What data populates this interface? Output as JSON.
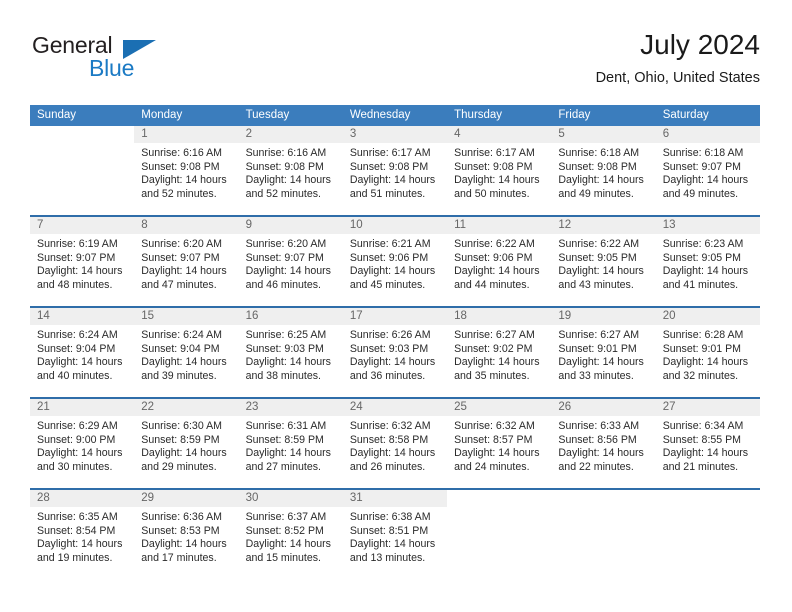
{
  "brand": {
    "name_part1": "General",
    "name_part2": "Blue",
    "triangle_icon": "triangle-icon",
    "accent_color": "#1b7ac4"
  },
  "header": {
    "title": "July 2024",
    "subtitle": "Dent, Ohio, United States"
  },
  "colors": {
    "header_blue": "#3b7dbd",
    "row_divider_blue": "#2f6da9",
    "daynum_bg": "#efefef",
    "text": "#2a2a2a"
  },
  "weekday_headers": [
    "Sunday",
    "Monday",
    "Tuesday",
    "Wednesday",
    "Thursday",
    "Friday",
    "Saturday"
  ],
  "weeks": [
    [
      {
        "day": "",
        "sunrise": "",
        "sunset": "",
        "daylight_line1": "",
        "daylight_line2": "",
        "empty": true
      },
      {
        "day": "1",
        "sunrise": "Sunrise: 6:16 AM",
        "sunset": "Sunset: 9:08 PM",
        "daylight_line1": "Daylight: 14 hours",
        "daylight_line2": "and 52 minutes."
      },
      {
        "day": "2",
        "sunrise": "Sunrise: 6:16 AM",
        "sunset": "Sunset: 9:08 PM",
        "daylight_line1": "Daylight: 14 hours",
        "daylight_line2": "and 52 minutes."
      },
      {
        "day": "3",
        "sunrise": "Sunrise: 6:17 AM",
        "sunset": "Sunset: 9:08 PM",
        "daylight_line1": "Daylight: 14 hours",
        "daylight_line2": "and 51 minutes."
      },
      {
        "day": "4",
        "sunrise": "Sunrise: 6:17 AM",
        "sunset": "Sunset: 9:08 PM",
        "daylight_line1": "Daylight: 14 hours",
        "daylight_line2": "and 50 minutes."
      },
      {
        "day": "5",
        "sunrise": "Sunrise: 6:18 AM",
        "sunset": "Sunset: 9:08 PM",
        "daylight_line1": "Daylight: 14 hours",
        "daylight_line2": "and 49 minutes."
      },
      {
        "day": "6",
        "sunrise": "Sunrise: 6:18 AM",
        "sunset": "Sunset: 9:07 PM",
        "daylight_line1": "Daylight: 14 hours",
        "daylight_line2": "and 49 minutes."
      }
    ],
    [
      {
        "day": "7",
        "sunrise": "Sunrise: 6:19 AM",
        "sunset": "Sunset: 9:07 PM",
        "daylight_line1": "Daylight: 14 hours",
        "daylight_line2": "and 48 minutes."
      },
      {
        "day": "8",
        "sunrise": "Sunrise: 6:20 AM",
        "sunset": "Sunset: 9:07 PM",
        "daylight_line1": "Daylight: 14 hours",
        "daylight_line2": "and 47 minutes."
      },
      {
        "day": "9",
        "sunrise": "Sunrise: 6:20 AM",
        "sunset": "Sunset: 9:07 PM",
        "daylight_line1": "Daylight: 14 hours",
        "daylight_line2": "and 46 minutes."
      },
      {
        "day": "10",
        "sunrise": "Sunrise: 6:21 AM",
        "sunset": "Sunset: 9:06 PM",
        "daylight_line1": "Daylight: 14 hours",
        "daylight_line2": "and 45 minutes."
      },
      {
        "day": "11",
        "sunrise": "Sunrise: 6:22 AM",
        "sunset": "Sunset: 9:06 PM",
        "daylight_line1": "Daylight: 14 hours",
        "daylight_line2": "and 44 minutes."
      },
      {
        "day": "12",
        "sunrise": "Sunrise: 6:22 AM",
        "sunset": "Sunset: 9:05 PM",
        "daylight_line1": "Daylight: 14 hours",
        "daylight_line2": "and 43 minutes."
      },
      {
        "day": "13",
        "sunrise": "Sunrise: 6:23 AM",
        "sunset": "Sunset: 9:05 PM",
        "daylight_line1": "Daylight: 14 hours",
        "daylight_line2": "and 41 minutes."
      }
    ],
    [
      {
        "day": "14",
        "sunrise": "Sunrise: 6:24 AM",
        "sunset": "Sunset: 9:04 PM",
        "daylight_line1": "Daylight: 14 hours",
        "daylight_line2": "and 40 minutes."
      },
      {
        "day": "15",
        "sunrise": "Sunrise: 6:24 AM",
        "sunset": "Sunset: 9:04 PM",
        "daylight_line1": "Daylight: 14 hours",
        "daylight_line2": "and 39 minutes."
      },
      {
        "day": "16",
        "sunrise": "Sunrise: 6:25 AM",
        "sunset": "Sunset: 9:03 PM",
        "daylight_line1": "Daylight: 14 hours",
        "daylight_line2": "and 38 minutes."
      },
      {
        "day": "17",
        "sunrise": "Sunrise: 6:26 AM",
        "sunset": "Sunset: 9:03 PM",
        "daylight_line1": "Daylight: 14 hours",
        "daylight_line2": "and 36 minutes."
      },
      {
        "day": "18",
        "sunrise": "Sunrise: 6:27 AM",
        "sunset": "Sunset: 9:02 PM",
        "daylight_line1": "Daylight: 14 hours",
        "daylight_line2": "and 35 minutes."
      },
      {
        "day": "19",
        "sunrise": "Sunrise: 6:27 AM",
        "sunset": "Sunset: 9:01 PM",
        "daylight_line1": "Daylight: 14 hours",
        "daylight_line2": "and 33 minutes."
      },
      {
        "day": "20",
        "sunrise": "Sunrise: 6:28 AM",
        "sunset": "Sunset: 9:01 PM",
        "daylight_line1": "Daylight: 14 hours",
        "daylight_line2": "and 32 minutes."
      }
    ],
    [
      {
        "day": "21",
        "sunrise": "Sunrise: 6:29 AM",
        "sunset": "Sunset: 9:00 PM",
        "daylight_line1": "Daylight: 14 hours",
        "daylight_line2": "and 30 minutes."
      },
      {
        "day": "22",
        "sunrise": "Sunrise: 6:30 AM",
        "sunset": "Sunset: 8:59 PM",
        "daylight_line1": "Daylight: 14 hours",
        "daylight_line2": "and 29 minutes."
      },
      {
        "day": "23",
        "sunrise": "Sunrise: 6:31 AM",
        "sunset": "Sunset: 8:59 PM",
        "daylight_line1": "Daylight: 14 hours",
        "daylight_line2": "and 27 minutes."
      },
      {
        "day": "24",
        "sunrise": "Sunrise: 6:32 AM",
        "sunset": "Sunset: 8:58 PM",
        "daylight_line1": "Daylight: 14 hours",
        "daylight_line2": "and 26 minutes."
      },
      {
        "day": "25",
        "sunrise": "Sunrise: 6:32 AM",
        "sunset": "Sunset: 8:57 PM",
        "daylight_line1": "Daylight: 14 hours",
        "daylight_line2": "and 24 minutes."
      },
      {
        "day": "26",
        "sunrise": "Sunrise: 6:33 AM",
        "sunset": "Sunset: 8:56 PM",
        "daylight_line1": "Daylight: 14 hours",
        "daylight_line2": "and 22 minutes."
      },
      {
        "day": "27",
        "sunrise": "Sunrise: 6:34 AM",
        "sunset": "Sunset: 8:55 PM",
        "daylight_line1": "Daylight: 14 hours",
        "daylight_line2": "and 21 minutes."
      }
    ],
    [
      {
        "day": "28",
        "sunrise": "Sunrise: 6:35 AM",
        "sunset": "Sunset: 8:54 PM",
        "daylight_line1": "Daylight: 14 hours",
        "daylight_line2": "and 19 minutes."
      },
      {
        "day": "29",
        "sunrise": "Sunrise: 6:36 AM",
        "sunset": "Sunset: 8:53 PM",
        "daylight_line1": "Daylight: 14 hours",
        "daylight_line2": "and 17 minutes."
      },
      {
        "day": "30",
        "sunrise": "Sunrise: 6:37 AM",
        "sunset": "Sunset: 8:52 PM",
        "daylight_line1": "Daylight: 14 hours",
        "daylight_line2": "and 15 minutes."
      },
      {
        "day": "31",
        "sunrise": "Sunrise: 6:38 AM",
        "sunset": "Sunset: 8:51 PM",
        "daylight_line1": "Daylight: 14 hours",
        "daylight_line2": "and 13 minutes."
      },
      {
        "day": "",
        "sunrise": "",
        "sunset": "",
        "daylight_line1": "",
        "daylight_line2": "",
        "empty": true
      },
      {
        "day": "",
        "sunrise": "",
        "sunset": "",
        "daylight_line1": "",
        "daylight_line2": "",
        "empty": true
      },
      {
        "day": "",
        "sunrise": "",
        "sunset": "",
        "daylight_line1": "",
        "daylight_line2": "",
        "empty": true
      }
    ]
  ]
}
